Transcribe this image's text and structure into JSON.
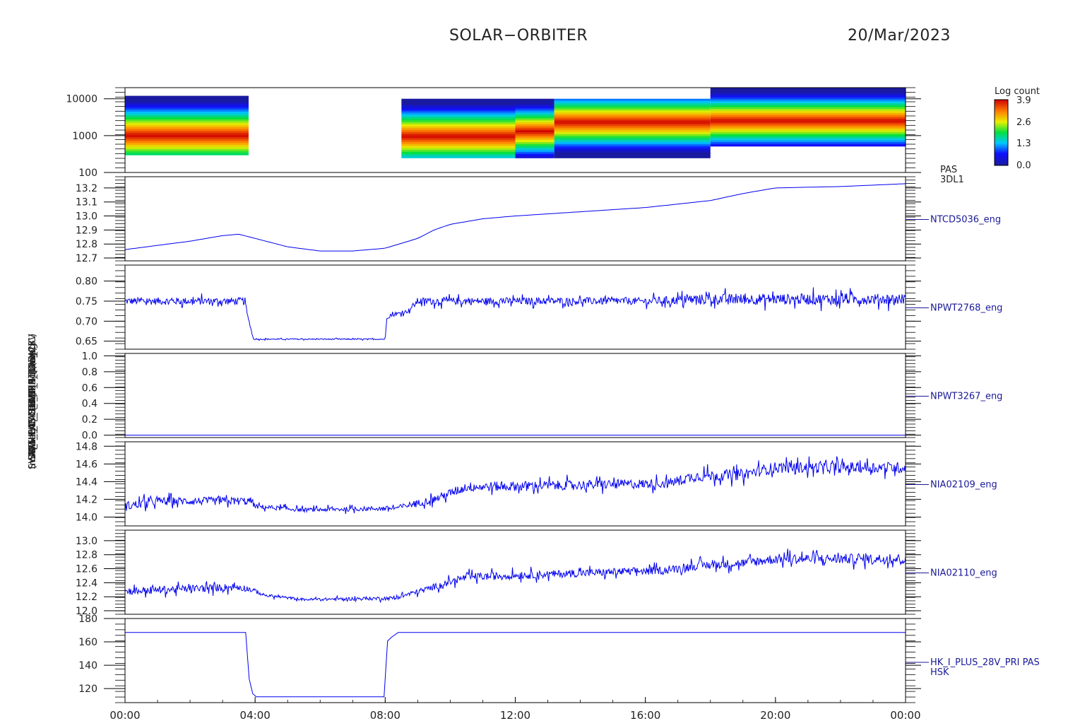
{
  "header": {
    "mission": "SOLAR−ORBITER",
    "date": "20/Mar/2023"
  },
  "ylabels": [
    "(eV)",
    "(DegC) Temp  (Approx",
    "SWA_EAS_TEMP_1 (DegC)",
    "SWA_HK_EAS_TEMP_2 (DegC)",
    "SWA_PAS_TEMP_1 (DegC)",
    "PAS_HK_CURRENT (mA)",
    "(mA) HK_IMON_PRIMARY_28V"
  ],
  "colorbar": {
    "title": "Log count",
    "ticks": [
      "3.9",
      "2.6",
      "1.3",
      "0.0"
    ]
  },
  "chart_data": {
    "type": "multi-panel",
    "x_ticks": [
      "00:00",
      "04:00",
      "08:00",
      "12:00",
      "16:00",
      "20:00",
      "00:00"
    ],
    "x_range_hours": [
      0,
      24
    ],
    "panels": [
      {
        "type": "heatmap",
        "label_lines": [
          "PAS",
          "3DL1"
        ],
        "yscale": "log",
        "ylim": [
          100,
          20000
        ],
        "y_ticks": [
          "10000",
          "1000",
          "100"
        ],
        "y_tick_values": [
          10000,
          1000,
          100
        ],
        "segments": [
          {
            "t": [
              0,
              3.8
            ],
            "ylim": [
              300,
              12000
            ],
            "peak": 1000
          },
          {
            "t": [
              8.5,
              12.0
            ],
            "ylim": [
              250,
              10000
            ],
            "peak": 950
          },
          {
            "t": [
              12.0,
              13.2
            ],
            "ylim": [
              250,
              10000
            ],
            "peak": 1300
          },
          {
            "t": [
              13.2,
              18.0
            ],
            "ylim": [
              250,
              10000
            ],
            "peak": 2300
          },
          {
            "t": [
              18.0,
              24.0
            ],
            "ylim": [
              520,
              20000
            ],
            "peak": 2500
          }
        ],
        "colorscale": [
          0.0,
          3.9
        ]
      },
      {
        "type": "line",
        "name": "NTCD5036_eng",
        "ylim": [
          12.68,
          13.28
        ],
        "y_ticks": [
          "13.2",
          "13.1",
          "13.0",
          "12.9",
          "12.8",
          "12.7"
        ],
        "y_tick_values": [
          13.2,
          13.1,
          13.0,
          12.9,
          12.8,
          12.7
        ],
        "x": [
          0,
          1,
          2,
          3,
          3.5,
          4,
          5,
          6,
          7,
          8,
          9,
          9.5,
          10,
          11,
          12,
          14,
          16,
          18,
          19,
          20,
          22,
          24
        ],
        "y": [
          12.76,
          12.79,
          12.82,
          12.86,
          12.87,
          12.84,
          12.78,
          12.75,
          12.75,
          12.77,
          12.84,
          12.9,
          12.94,
          12.98,
          13.0,
          13.03,
          13.06,
          13.11,
          13.16,
          13.2,
          13.21,
          13.23
        ]
      },
      {
        "type": "line",
        "name": "NPWT2768_eng",
        "ylim": [
          0.63,
          0.84
        ],
        "y_ticks": [
          "0.80",
          "0.75",
          "0.70",
          "0.65"
        ],
        "y_tick_values": [
          0.8,
          0.75,
          0.7,
          0.65
        ],
        "x": [
          0,
          3.7,
          3.75,
          3.95,
          8.0,
          8.05,
          8.2,
          8.7,
          9.0,
          12,
          16,
          18,
          24
        ],
        "y": [
          0.75,
          0.75,
          0.72,
          0.655,
          0.655,
          0.71,
          0.715,
          0.725,
          0.75,
          0.75,
          0.75,
          0.755,
          0.755
        ],
        "noise": [
          0.02,
          0.02,
          0.005,
          0.003,
          0.003,
          0.01,
          0.01,
          0.01,
          0.02,
          0.02,
          0.02,
          0.03,
          0.03
        ]
      },
      {
        "type": "line",
        "name": "NPWT3267_eng",
        "ylim": [
          -0.03,
          1.03
        ],
        "y_ticks": [
          "1.0",
          "0.8",
          "0.6",
          "0.4",
          "0.2",
          "0.0"
        ],
        "y_tick_values": [
          1.0,
          0.8,
          0.6,
          0.4,
          0.2,
          0.0
        ],
        "x": [
          0,
          24
        ],
        "y": [
          0.0,
          0.0
        ]
      },
      {
        "type": "line",
        "name": "NIA02109_eng",
        "ylim": [
          13.9,
          14.85
        ],
        "y_ticks": [
          "14.8",
          "14.6",
          "14.4",
          "14.2",
          "14.0"
        ],
        "y_tick_values": [
          14.8,
          14.6,
          14.4,
          14.2,
          14.0
        ],
        "x": [
          0,
          1,
          3.9,
          4.0,
          5.5,
          8.3,
          9.5,
          10.5,
          16.7,
          17.5,
          19.0,
          20.0,
          24
        ],
        "y": [
          14.12,
          14.18,
          14.18,
          14.12,
          14.08,
          14.1,
          14.2,
          14.34,
          14.38,
          14.46,
          14.48,
          14.56,
          14.56
        ],
        "noise": [
          0.12,
          0.1,
          0.1,
          0.06,
          0.05,
          0.06,
          0.1,
          0.12,
          0.12,
          0.14,
          0.14,
          0.14,
          0.14
        ]
      },
      {
        "type": "line",
        "name": "NIA02110_eng",
        "ylim": [
          11.95,
          13.15
        ],
        "y_ticks": [
          "13.0",
          "12.8",
          "12.6",
          "12.4",
          "12.2",
          "12.0"
        ],
        "y_tick_values": [
          13.0,
          12.8,
          12.6,
          12.4,
          12.2,
          12.0
        ],
        "x": [
          0,
          3.5,
          3.9,
          4.3,
          5.5,
          8.3,
          9.5,
          10.5,
          16.7,
          17.5,
          19.0,
          20.0,
          24
        ],
        "y": [
          12.28,
          12.34,
          12.3,
          12.22,
          12.16,
          12.18,
          12.34,
          12.48,
          12.58,
          12.64,
          12.68,
          12.74,
          12.74
        ],
        "noise": [
          0.12,
          0.12,
          0.08,
          0.04,
          0.04,
          0.06,
          0.1,
          0.12,
          0.12,
          0.14,
          0.14,
          0.16,
          0.16
        ]
      },
      {
        "type": "line",
        "name": "HK_I_PLUS_28V_PRI PAS",
        "name2": "HSK",
        "ylim": [
          108,
          180
        ],
        "y_ticks": [
          "180",
          "160",
          "140",
          "120"
        ],
        "y_tick_values": [
          180,
          160,
          140,
          120
        ],
        "x": [
          0,
          3.75,
          3.8,
          3.85,
          3.95,
          8.0,
          8.05,
          8.15,
          8.4,
          12.0,
          12.05,
          12.1,
          24
        ],
        "y": [
          168,
          168,
          130,
          125,
          113,
          113,
          160,
          163,
          168,
          168,
          171,
          168,
          168
        ]
      }
    ]
  }
}
